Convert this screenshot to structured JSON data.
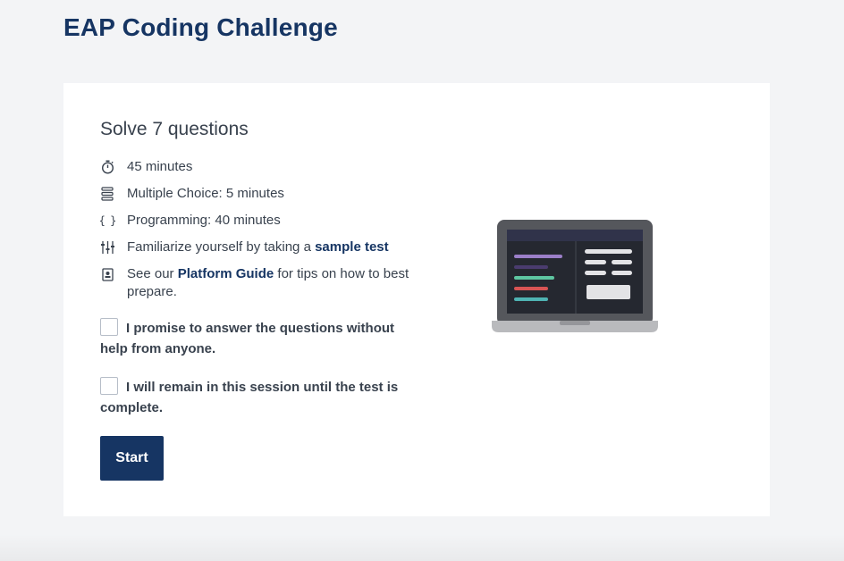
{
  "page": {
    "title": "EAP Coding Challenge"
  },
  "card": {
    "heading": "Solve 7 questions",
    "info": {
      "time": "45 minutes",
      "mcq": "Multiple Choice: 5 minutes",
      "programming": "Programming: 40 minutes",
      "sample_prefix": "Familiarize yourself by taking a ",
      "sample_link": "sample test",
      "guide_prefix": "See our ",
      "guide_link": "Platform Guide",
      "guide_suffix": " for tips on how to best prepare."
    },
    "icons": {
      "time": "stopwatch-icon",
      "mcq": "list-icon",
      "programming": "braces-icon",
      "sample": "sliders-icon",
      "guide": "book-icon"
    },
    "checks": {
      "promise": "I promise to answer the questions without help from anyone.",
      "remain": "I will remain in this session until the test is complete."
    },
    "start_label": "Start"
  },
  "colors": {
    "brand": "#163563",
    "text": "#39424e",
    "background": "#f3f4f6"
  }
}
